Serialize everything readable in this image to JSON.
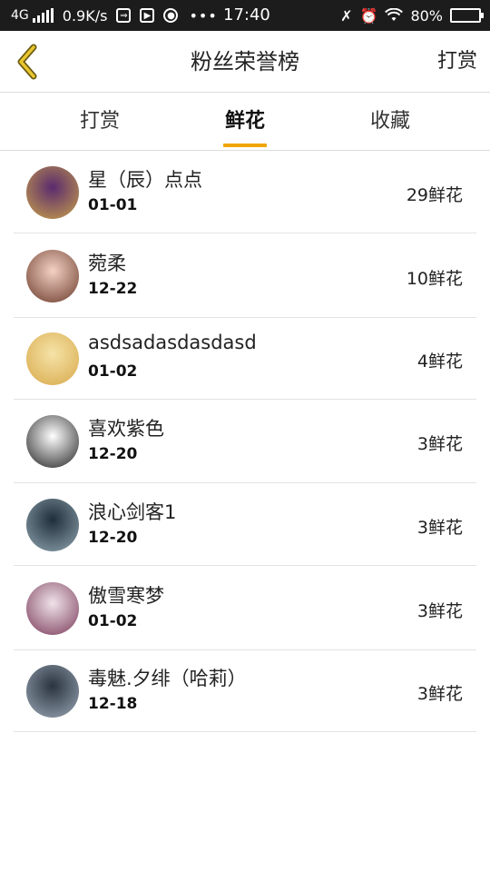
{
  "status_bar": {
    "network": "4G",
    "speed": "0.9K/s",
    "time": "17:40",
    "battery": "80%",
    "battery_level": 0.8
  },
  "header": {
    "title": "粉丝荣誉榜",
    "action": "打赏"
  },
  "tabs": [
    {
      "label": "打赏",
      "active": false
    },
    {
      "label": "鲜花",
      "active": true
    },
    {
      "label": "收藏",
      "active": false
    }
  ],
  "accent_color": "#f0a500",
  "fans": [
    {
      "name": "星（辰）点点",
      "date": "01-01",
      "count": "29鲜花",
      "avatar_colors": [
        "#5a2a6e",
        "#c9a14a"
      ]
    },
    {
      "name": "菀柔",
      "date": "12-22",
      "count": "10鲜花",
      "avatar_colors": [
        "#f3d2c4",
        "#6b3a2a"
      ]
    },
    {
      "name": "asdsadasdasdasd",
      "date": "01-02",
      "count": "4鲜花",
      "avatar_colors": [
        "#f5e3a8",
        "#d8a94a"
      ]
    },
    {
      "name": "喜欢紫色",
      "date": "12-20",
      "count": "3鲜花",
      "avatar_colors": [
        "#ffffff",
        "#222222"
      ]
    },
    {
      "name": "浪心剑客1",
      "date": "12-20",
      "count": "3鲜花",
      "avatar_colors": [
        "#1f2e3a",
        "#8fa4b0"
      ]
    },
    {
      "name": "傲雪寒梦",
      "date": "01-02",
      "count": "3鲜花",
      "avatar_colors": [
        "#efe3e8",
        "#7a3a5a"
      ]
    },
    {
      "name": "毒魅.夕绯（哈莉）",
      "date": "12-18",
      "count": "3鲜花",
      "avatar_colors": [
        "#2a3340",
        "#9aa7b5"
      ]
    }
  ]
}
